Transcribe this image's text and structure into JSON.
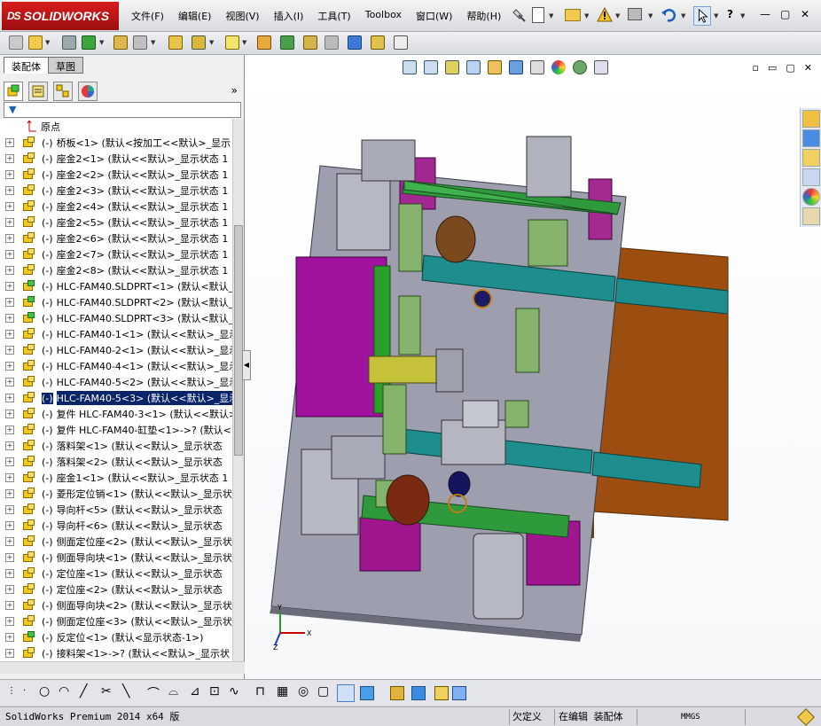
{
  "app": {
    "brand": "SOLIDWORKS",
    "brand_prefix": "DS"
  },
  "menu": [
    "文件(F)",
    "编辑(E)",
    "视图(V)",
    "插入(I)",
    "工具(T)",
    "Toolbox",
    "窗口(W)",
    "帮助(H)"
  ],
  "window_controls": {
    "minimize": "—",
    "restore": "▢",
    "close": "✕",
    "help": "?"
  },
  "icons": {
    "pin": "pin-icon",
    "new": "new-document-icon",
    "open": "open-folder-icon",
    "rebuild": "rebuild-warning-icon",
    "print": "print-icon",
    "undo": "undo-icon",
    "select": "select-arrow-icon",
    "help": "help-icon"
  },
  "tabs": {
    "assembly": "装配体",
    "sketch": "草图"
  },
  "feature_tree": {
    "origin": "原点",
    "items": [
      {
        "state": "(-)",
        "text": "桥板<1> (默认<按加工<<默认>_显示",
        "green": false,
        "selected": false
      },
      {
        "state": "(-)",
        "text": "座金2<1> (默认<<默认>_显示状态 1",
        "green": false,
        "selected": false
      },
      {
        "state": "(-)",
        "text": "座金2<2> (默认<<默认>_显示状态 1",
        "green": false,
        "selected": false
      },
      {
        "state": "(-)",
        "text": "座金2<3> (默认<<默认>_显示状态 1",
        "green": false,
        "selected": false
      },
      {
        "state": "(-)",
        "text": "座金2<4> (默认<<默认>_显示状态 1",
        "green": false,
        "selected": false
      },
      {
        "state": "(-)",
        "text": "座金2<5> (默认<<默认>_显示状态 1",
        "green": false,
        "selected": false
      },
      {
        "state": "(-)",
        "text": "座金2<6> (默认<<默认>_显示状态 1",
        "green": false,
        "selected": false
      },
      {
        "state": "(-)",
        "text": "座金2<7> (默认<<默认>_显示状态 1",
        "green": false,
        "selected": false
      },
      {
        "state": "(-)",
        "text": "座金2<8> (默认<<默认>_显示状态 1",
        "green": false,
        "selected": false
      },
      {
        "state": "(-)",
        "text": "HLC-FAM40.SLDPRT<1> (默认<默认_显",
        "green": true,
        "selected": false
      },
      {
        "state": "(-)",
        "text": "HLC-FAM40.SLDPRT<2> (默认<默认_显",
        "green": true,
        "selected": false
      },
      {
        "state": "(-)",
        "text": "HLC-FAM40.SLDPRT<3> (默认<默认_显",
        "green": true,
        "selected": false
      },
      {
        "state": "(-)",
        "text": "HLC-FAM40-1<1> (默认<<默认>_显示",
        "green": false,
        "selected": false
      },
      {
        "state": "(-)",
        "text": "HLC-FAM40-2<1> (默认<<默认>_显示",
        "green": false,
        "selected": false
      },
      {
        "state": "(-)",
        "text": "HLC-FAM40-4<1> (默认<<默认>_显示",
        "green": false,
        "selected": false
      },
      {
        "state": "(-)",
        "text": "HLC-FAM40-5<2> (默认<<默认>_显示",
        "green": false,
        "selected": false
      },
      {
        "state": "(-)",
        "text": "HLC-FAM40-5<3> (默认<<默认>_显示",
        "green": false,
        "selected": true
      },
      {
        "state": "(-)",
        "text": "复件 HLC-FAM40-3<1> (默认<<默认>",
        "green": false,
        "selected": false
      },
      {
        "state": "(-)",
        "text": "复件 HLC-FAM40-缸垫<1>->? (默认<",
        "green": false,
        "selected": false
      },
      {
        "state": "(-)",
        "text": "落料架<1> (默认<<默认>_显示状态",
        "green": false,
        "selected": false
      },
      {
        "state": "(-)",
        "text": "落料架<2> (默认<<默认>_显示状态",
        "green": false,
        "selected": false
      },
      {
        "state": "(-)",
        "text": "座金1<1> (默认<<默认>_显示状态 1",
        "green": false,
        "selected": false
      },
      {
        "state": "(-)",
        "text": "菱形定位销<1> (默认<<默认>_显示状",
        "green": false,
        "selected": false
      },
      {
        "state": "(-)",
        "text": "导向杆<5> (默认<<默认>_显示状态",
        "green": false,
        "selected": false
      },
      {
        "state": "(-)",
        "text": "导向杆<6> (默认<<默认>_显示状态",
        "green": false,
        "selected": false
      },
      {
        "state": "(-)",
        "text": "侧面定位座<2> (默认<<默认>_显示状",
        "green": false,
        "selected": false
      },
      {
        "state": "(-)",
        "text": "侧面导向块<1> (默认<<默认>_显示状",
        "green": false,
        "selected": false
      },
      {
        "state": "(-)",
        "text": "定位座<1> (默认<<默认>_显示状态",
        "green": false,
        "selected": false
      },
      {
        "state": "(-)",
        "text": "定位座<2> (默认<<默认>_显示状态",
        "green": false,
        "selected": false
      },
      {
        "state": "(-)",
        "text": "侧面导向块<2> (默认<<默认>_显示状",
        "green": false,
        "selected": false
      },
      {
        "state": "(-)",
        "text": "侧面定位座<3> (默认<<默认>_显示状",
        "green": false,
        "selected": false
      },
      {
        "state": "(-)",
        "text": "反定位<1> (默认<显示状态-1>)",
        "green": true,
        "selected": false
      },
      {
        "state": "(-)",
        "text": "接料架<1>->? (默认<<默认>_显示状",
        "green": false,
        "selected": false
      },
      {
        "state": "(-)",
        "text": "复件 落料架<1> (默认<<默认>_显示状",
        "green": false,
        "selected": false
      }
    ]
  },
  "triad": {
    "x": "X",
    "y": "Y",
    "z": "Z"
  },
  "status": {
    "product": "SolidWorks Premium 2014 x64 版",
    "definition": "欠定义",
    "editing": "在编辑 装配体",
    "units": "MMGS"
  }
}
